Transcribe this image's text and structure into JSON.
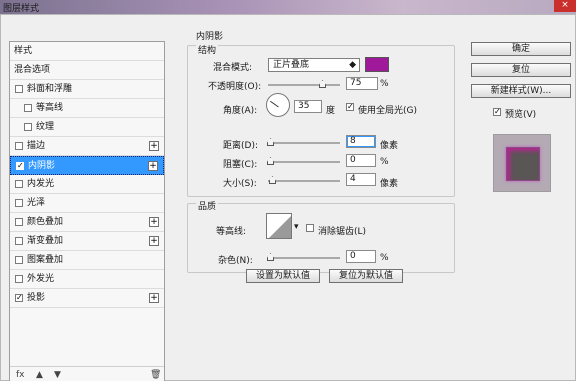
{
  "window": {
    "title": "图层样式",
    "close_label": "×"
  },
  "left": {
    "items": [
      {
        "label": "样式",
        "checkbox": false,
        "checked": false,
        "plus": false
      },
      {
        "label": "混合选项",
        "checkbox": false,
        "checked": false,
        "plus": false
      },
      {
        "label": "斜面和浮雕",
        "checkbox": true,
        "checked": false,
        "plus": false
      },
      {
        "label": "等高线",
        "checkbox": true,
        "checked": false,
        "plus": false,
        "indent": true
      },
      {
        "label": "纹理",
        "checkbox": true,
        "checked": false,
        "plus": false,
        "indent": true
      },
      {
        "label": "描边",
        "checkbox": true,
        "checked": false,
        "plus": true
      },
      {
        "label": "内阴影",
        "checkbox": true,
        "checked": true,
        "plus": true,
        "selected": true
      },
      {
        "label": "内发光",
        "checkbox": true,
        "checked": false,
        "plus": false
      },
      {
        "label": "光泽",
        "checkbox": true,
        "checked": false,
        "plus": false
      },
      {
        "label": "颜色叠加",
        "checkbox": true,
        "checked": false,
        "plus": true
      },
      {
        "label": "渐变叠加",
        "checkbox": true,
        "checked": false,
        "plus": true
      },
      {
        "label": "图案叠加",
        "checkbox": true,
        "checked": false,
        "plus": false
      },
      {
        "label": "外发光",
        "checkbox": true,
        "checked": false,
        "plus": false
      },
      {
        "label": "投影",
        "checkbox": true,
        "checked": true,
        "plus": true
      }
    ],
    "bottom": {
      "fx": "fx",
      "up": "▲",
      "down": "▼",
      "trash": "🗑"
    }
  },
  "main": {
    "section_title": "内阴影",
    "structure_title": "结构",
    "blend_mode_label": "混合模式:",
    "blend_mode_value": "正片叠底",
    "color": "#a0199a",
    "opacity_label": "不透明度(O):",
    "opacity_value": "75",
    "opacity_unit": "%",
    "opacity": 0.75,
    "angle_label": "角度(A):",
    "angle_value": "35",
    "angle_unit": "度",
    "global_light_label": "使用全局光(G)",
    "global_light_checked": true,
    "distance_label": "距离(D):",
    "distance_value": "8",
    "distance_unit": "像素",
    "choke_label": "阻塞(C):",
    "choke_value": "0",
    "choke_unit": "%",
    "size_label": "大小(S):",
    "size_value": "4",
    "size_unit": "像素",
    "quality_title": "品质",
    "contour_label": "等高线:",
    "antialias_label": "消除锯齿(L)",
    "noise_label": "杂色(N):",
    "noise_value": "0",
    "noise_unit": "%",
    "set_default_label": "设置为默认值",
    "reset_default_label": "复位为默认值"
  },
  "right": {
    "ok_label": "确定",
    "reset_label": "复位",
    "new_style_label": "新建样式(W)...",
    "preview_label": "预览(V)",
    "preview_checked": true
  }
}
